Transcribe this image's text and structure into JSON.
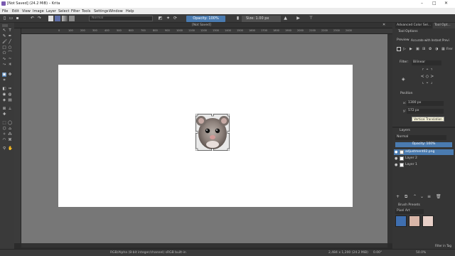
{
  "window": {
    "title": "[Not Saved]  (24.2 MiB)  – Krita",
    "controls": [
      "–",
      "□",
      "✕"
    ]
  },
  "menubar": [
    "File",
    "Edit",
    "View",
    "Image",
    "Layer",
    "Select",
    "Filter",
    "Tools",
    "Settings",
    "Window",
    "Help"
  ],
  "toolbar": {
    "blend_mode": "Normal",
    "opacity_label": "Opacity: 100%",
    "size_label": "Size: 1.00 px",
    "icons": [
      "new-doc-icon",
      "open-icon",
      "save-icon",
      "undo-icon",
      "redo-icon",
      "pattern-icon",
      "gradient-icon",
      "brush-icon",
      "erase-icon",
      "preserve-alpha-icon",
      "reload-icon",
      "mirror-h-icon",
      "mirror-v-icon",
      "wrap-icon"
    ]
  },
  "document": {
    "tab_title": "[Not Saved]",
    "ruler_ticks": [
      "0",
      "100",
      "200",
      "300",
      "400",
      "500",
      "600",
      "700",
      "800",
      "900",
      "1000",
      "1100",
      "1200",
      "1300",
      "1400",
      "1500",
      "1600",
      "1700",
      "1800",
      "1900",
      "2000",
      "2100",
      "2200",
      "2300",
      "2400"
    ]
  },
  "right_panel": {
    "tabs": [
      "Advanced Color Sel...",
      "Tool Opt..."
    ],
    "tool_options_title": "Tool Options",
    "preview_label": "Preview",
    "preview_mode": "Accurate with Instant Previ",
    "free_label": "Frer",
    "filter_label": "Filter:",
    "filter_value": "Bilinear",
    "position_label": "Position",
    "x_label": "x:",
    "x_value": "1300 px",
    "y_label": "y:",
    "y_value": "572 px",
    "tooltip": "Vertical Translation",
    "layers_title": "Layers",
    "layers_blend": "Normal",
    "layers_opacity": "Opacity:  100%",
    "layers": [
      {
        "name": "adjustment02.png",
        "selected": true
      },
      {
        "name": "Layer 2",
        "selected": false
      },
      {
        "name": "Layer 1",
        "selected": false
      }
    ],
    "brush_presets_title": "Brush Presets",
    "brush_preset_tag": "Pixel Art",
    "filter_in_tag": "Filter in Tag"
  },
  "statusbar": {
    "color_info": "RGB/Alpha (8-bit integer/channel)  sRGB built-in",
    "dimensions": "2,484 x 1,200 (24.2 MiB)",
    "rotation": "0.00°",
    "zoom": "50.0%"
  },
  "colors": {
    "accent": "#4a7bb0",
    "canvas_bg": "#777777",
    "panel_bg": "#353535"
  }
}
